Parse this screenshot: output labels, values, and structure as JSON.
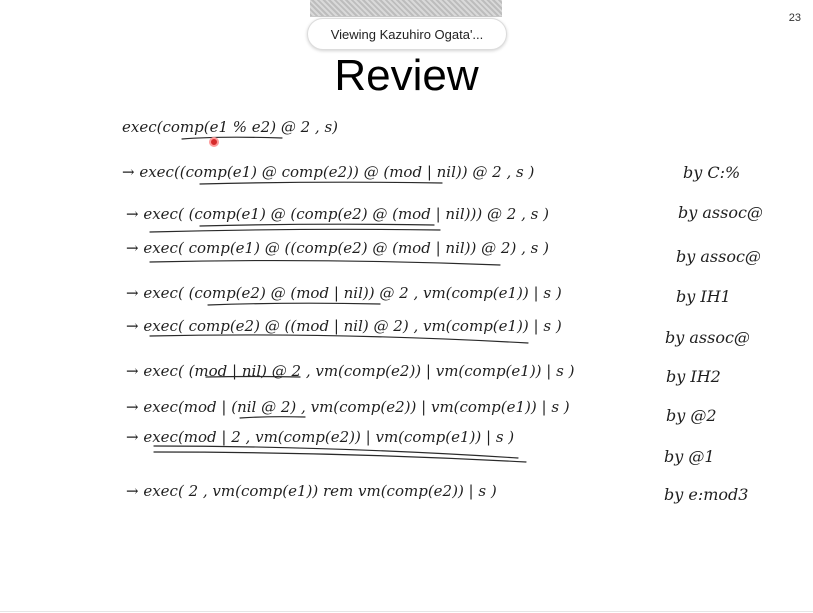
{
  "toolbar": {
    "viewing_label": "Viewing Kazuhiro Ogata'..."
  },
  "slide": {
    "page_number": "23",
    "title": "Review",
    "steps": [
      {
        "expr": "exec(comp(e1 % e2) @ 2 , s)",
        "by": ""
      },
      {
        "expr": "→ exec((comp(e1) @ comp(e2)) @ (mod | nil)) @ 2 , s )",
        "by": "by C:%"
      },
      {
        "expr": "→ exec( (comp(e1) @ (comp(e2) @ (mod | nil))) @ 2 , s )",
        "by": "by assoc@"
      },
      {
        "expr": "→ exec( comp(e1) @ ((comp(e2) @ (mod | nil)) @ 2) , s )",
        "by": "by assoc@"
      },
      {
        "expr": "→ exec( (comp(e2) @ (mod | nil)) @ 2 , vm(comp(e1)) | s )",
        "by": "by IH1"
      },
      {
        "expr": "→ exec( comp(e2) @ ((mod | nil) @ 2) , vm(comp(e1)) | s )",
        "by": "by assoc@"
      },
      {
        "expr": "→ exec( (mod | nil) @ 2 , vm(comp(e2)) | vm(comp(e1)) | s )",
        "by": "by IH2"
      },
      {
        "expr": "→ exec(mod | (nil @ 2) , vm(comp(e2)) | vm(comp(e1)) | s )",
        "by": "by @2"
      },
      {
        "expr": "→ exec(mod | 2 , vm(comp(e2)) | vm(comp(e1)) | s )",
        "by": "by @1"
      },
      {
        "expr": "→ exec( 2 , vm(comp(e1)) rem vm(comp(e2)) | s )",
        "by": "by e:mod3"
      }
    ]
  },
  "colors": {
    "ink": "#1f1f1f",
    "pointer": "#d62b2b"
  }
}
